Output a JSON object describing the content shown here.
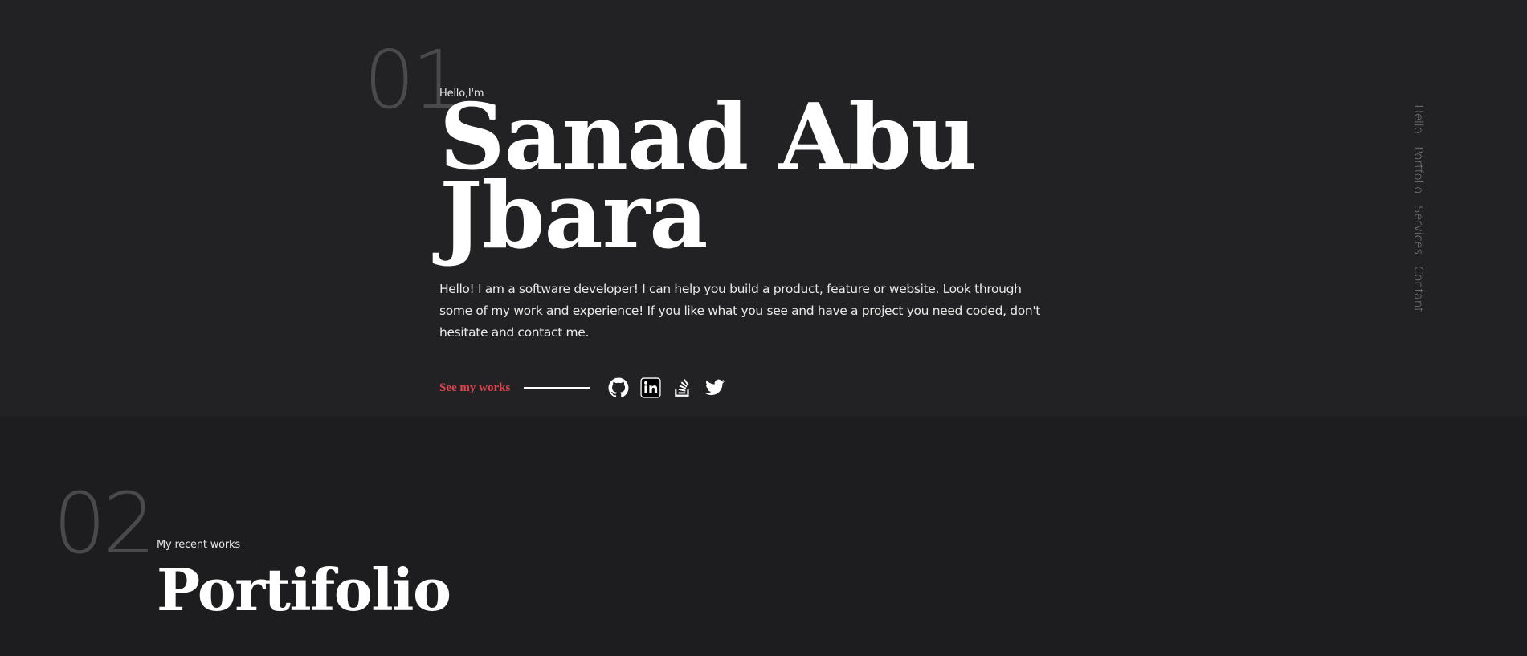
{
  "hero": {
    "number": "01",
    "eyebrow": "Hello,I'm",
    "name": "Sanad Abu Jbara",
    "intro": "Hello! I am a software developer! I can help you build a product, feature or website. Look through some of my work and experience! If you like what you see and have a project you need coded, don't hesitate and contact me.",
    "cta_label": "See my works",
    "socials": [
      {
        "name": "GitHub",
        "icon": "github-icon"
      },
      {
        "name": "LinkedIn",
        "icon": "linkedin-icon"
      },
      {
        "name": "Stack Overflow",
        "icon": "stackoverflow-icon"
      },
      {
        "name": "Twitter",
        "icon": "twitter-icon"
      }
    ]
  },
  "side_nav": {
    "items": [
      {
        "label": "Hello"
      },
      {
        "label": "Portfolio"
      },
      {
        "label": "Services"
      },
      {
        "label": "Contant"
      }
    ]
  },
  "portfolio": {
    "number": "02",
    "eyebrow": "My recent works",
    "title": "Portifolio"
  },
  "colors": {
    "background": "#222224",
    "accent": "#e0454d",
    "number": "#4a4a4c"
  }
}
